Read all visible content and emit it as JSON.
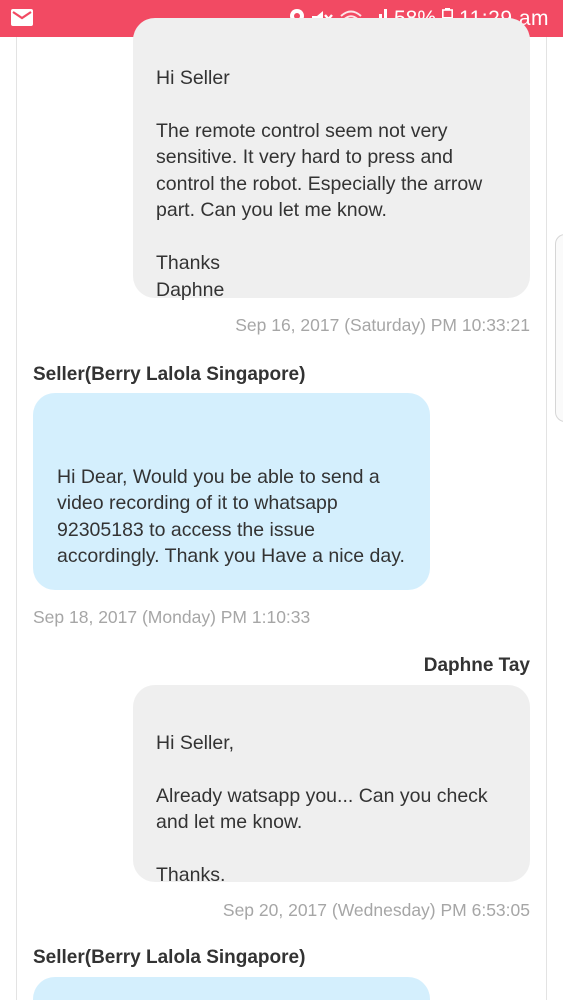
{
  "status_bar": {
    "battery_percent": "58%",
    "time": "11:29 am",
    "icons": [
      "mail-icon",
      "location-icon",
      "mute-icon",
      "wifi-icon",
      "signal-icon",
      "battery-icon"
    ],
    "background_color": "#f24a63"
  },
  "messages": [
    {
      "text": "Hi Seller\n\nThe remote control seem not very sensitive. It very hard to press and control the robot. Especially the arrow part. Can you let me know.\n\nThanks\nDaphne",
      "timestamp": "Sep 16, 2017 (Saturday) PM 10:33:21"
    },
    {
      "sender": "Seller(Berry Lalola Singapore)",
      "text": "Hi Dear, Would you be able to send a video recording of it to whatsapp 92305183 to access the issue accordingly. Thank you Have a nice day.",
      "timestamp": "Sep 18, 2017 (Monday) PM 1:10:33"
    },
    {
      "sender": "Daphne Tay",
      "text": "Hi Seller,\n\nAlready watsapp you... Can you check and let me know.\n\nThanks.",
      "timestamp": "Sep 20, 2017 (Wednesday) PM 6:53:05"
    },
    {
      "sender": "Seller(Berry Lalola Singapore)"
    }
  ],
  "colors": {
    "buyer_bubble": "#efefef",
    "seller_bubble": "#d4effd",
    "timestamp": "#a6a6a6"
  }
}
